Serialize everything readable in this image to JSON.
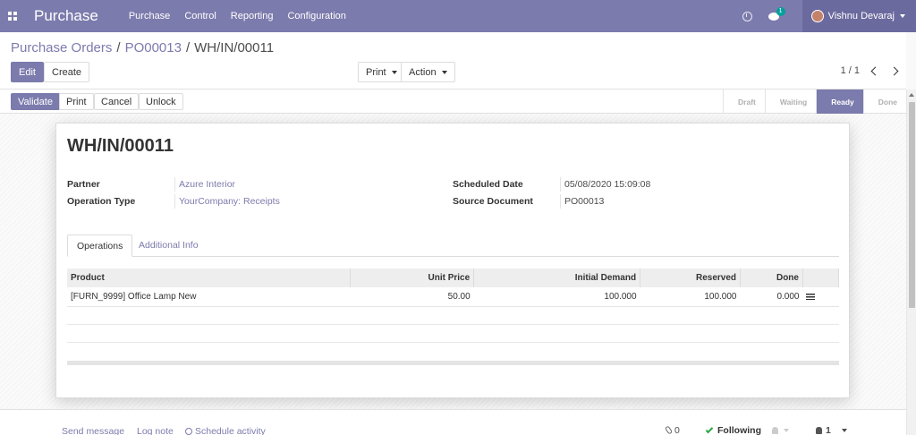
{
  "navbar": {
    "app_name": "Purchase",
    "menu": [
      "Purchase",
      "Control",
      "Reporting",
      "Configuration"
    ],
    "chat_count": "1",
    "user_name": "Vishnu Devaraj"
  },
  "breadcrumb": {
    "items": [
      "Purchase Orders",
      "PO00013"
    ],
    "current": "WH/IN/00011"
  },
  "toolbar": {
    "edit_label": "Edit",
    "create_label": "Create",
    "print_label": "Print",
    "action_label": "Action",
    "pager": "1 / 1"
  },
  "statusbar": {
    "buttons": [
      "Validate",
      "Print",
      "Cancel",
      "Unlock"
    ],
    "stages": [
      "Draft",
      "Waiting",
      "Ready",
      "Done"
    ],
    "active_stage": "Ready"
  },
  "record": {
    "title": "WH/IN/00011",
    "fields": {
      "partner_label": "Partner",
      "partner_value": "Azure Interior",
      "operation_type_label": "Operation Type",
      "operation_type_value": "YourCompany: Receipts",
      "scheduled_date_label": "Scheduled Date",
      "scheduled_date_value": "05/08/2020 15:09:08",
      "source_document_label": "Source Document",
      "source_document_value": "PO00013"
    },
    "tabs": [
      "Operations",
      "Additional Info"
    ],
    "table": {
      "columns": [
        "Product",
        "Unit Price",
        "Initial Demand",
        "Reserved",
        "Done"
      ],
      "rows": [
        {
          "product": "[FURN_9999] Office Lamp New",
          "unit_price": "50.00",
          "initial_demand": "100.000",
          "reserved": "100.000",
          "done": "0.000"
        }
      ]
    }
  },
  "chatter": {
    "send_message": "Send message",
    "log_note": "Log note",
    "schedule_activity": "Schedule activity",
    "attachments": "0",
    "following": "Following",
    "followers": "1"
  },
  "colors": {
    "brand": "#7c7bad",
    "brand_dark": "#6b6a9e",
    "success": "#28a745"
  }
}
